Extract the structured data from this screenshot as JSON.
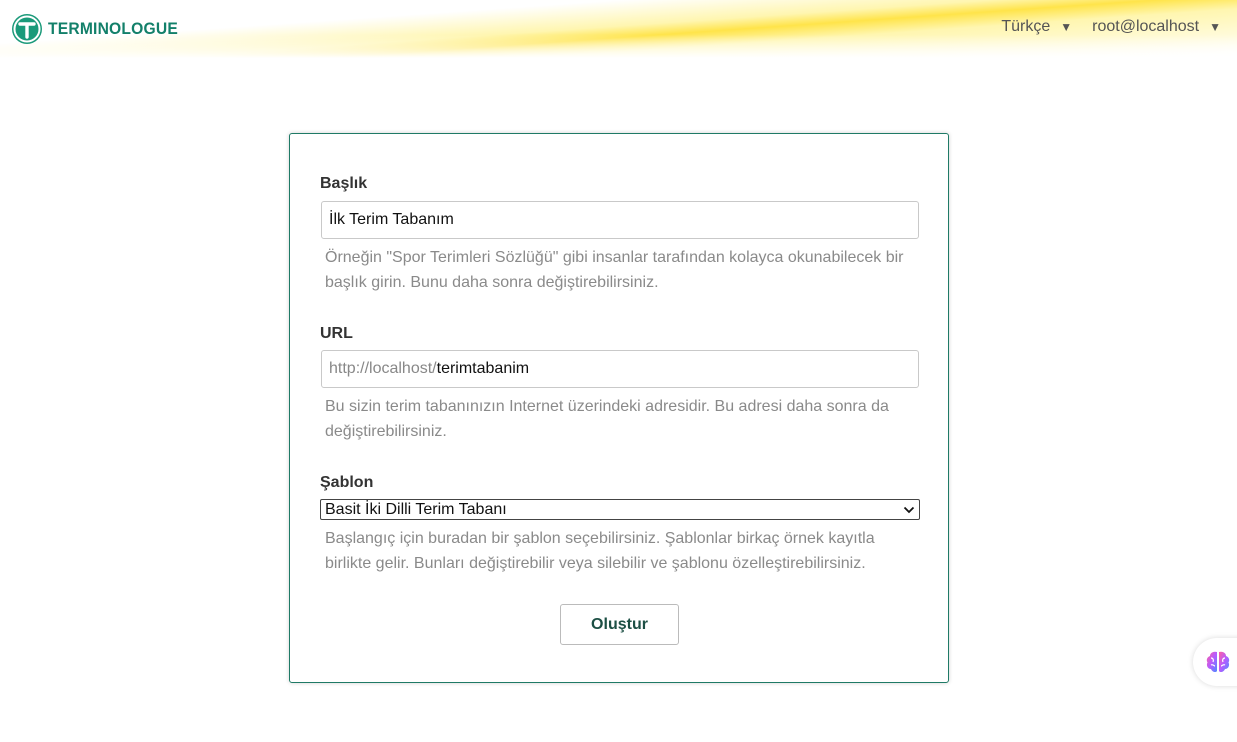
{
  "header": {
    "brand": "TERMINOLOGUE",
    "language": "Türkçe",
    "user": "root@localhost"
  },
  "form": {
    "title_label": "Başlık",
    "title_value": "İlk Terim Tabanım",
    "title_hint": "Örneğin \"Spor Terimleri Sözlüğü\" gibi insanlar tarafından kolayca okunabilecek bir başlık girin. Bunu daha sonra değiştirebilirsiniz.",
    "url_label": "URL",
    "url_prefix": "http://localhost/",
    "url_value": "terimtabanim",
    "url_hint": "Bu sizin terim tabanınızın Internet üzerindeki adresidir. Bu adresi daha sonra da değiştirebilirsiniz.",
    "template_label": "Şablon",
    "template_value": "Basit İki Dilli Terim Tabanı",
    "template_hint": "Başlangıç için buradan bir şablon seçebilirsiniz. Şablonlar birkaç örnek kayıtla birlikte gelir. Bunları değiştirebilir veya silebilir ve şablonu özelleştirebilirsiniz.",
    "submit_label": "Oluştur"
  },
  "colors": {
    "brand": "#13806a",
    "card_border": "#1f7a66",
    "header_accent": "#ffe44a"
  },
  "icons": {
    "logo": "terminologue-logo-icon",
    "caret": "caret-down-icon",
    "select_chevron": "chevron-down-icon",
    "helper": "brain-icon"
  }
}
